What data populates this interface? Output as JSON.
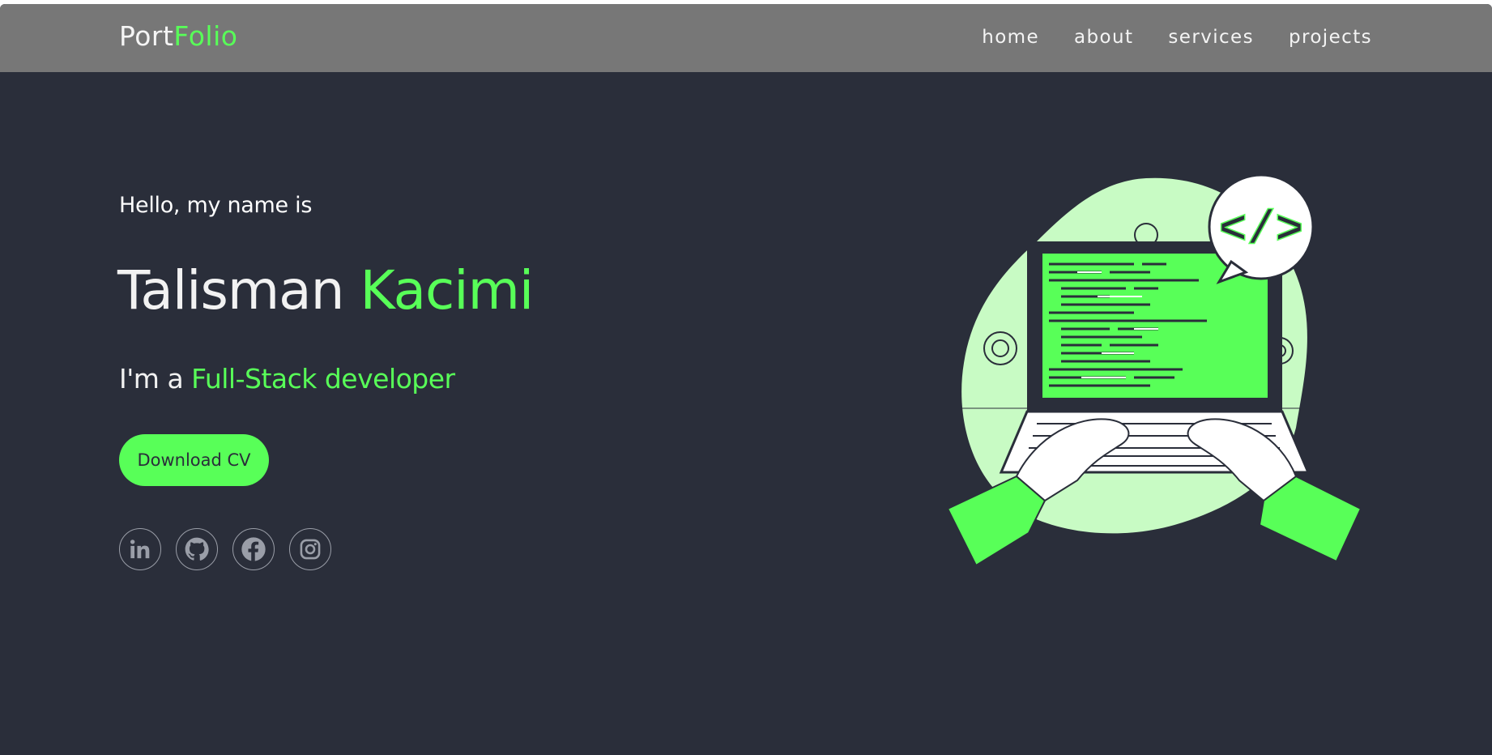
{
  "header": {
    "logo_part1": "Port",
    "logo_part2": "Folio",
    "nav": [
      {
        "label": "home"
      },
      {
        "label": "about"
      },
      {
        "label": "services"
      },
      {
        "label": "projects"
      }
    ]
  },
  "hero": {
    "greeting": "Hello, my name is",
    "first_name": "Talisman",
    "last_name": "Kacimi",
    "role_prefix": "I'm a",
    "role": "Full-Stack developer",
    "cta_label": "Download CV"
  },
  "socials": [
    {
      "icon": "linkedin-icon"
    },
    {
      "icon": "github-icon"
    },
    {
      "icon": "facebook-icon"
    },
    {
      "icon": "instagram-icon"
    }
  ],
  "illustration": {
    "code_symbol": "</>"
  },
  "colors": {
    "background": "#2a2e3a",
    "navbar": "#777777",
    "accent": "#58ff58",
    "text": "#f2f2f2"
  }
}
